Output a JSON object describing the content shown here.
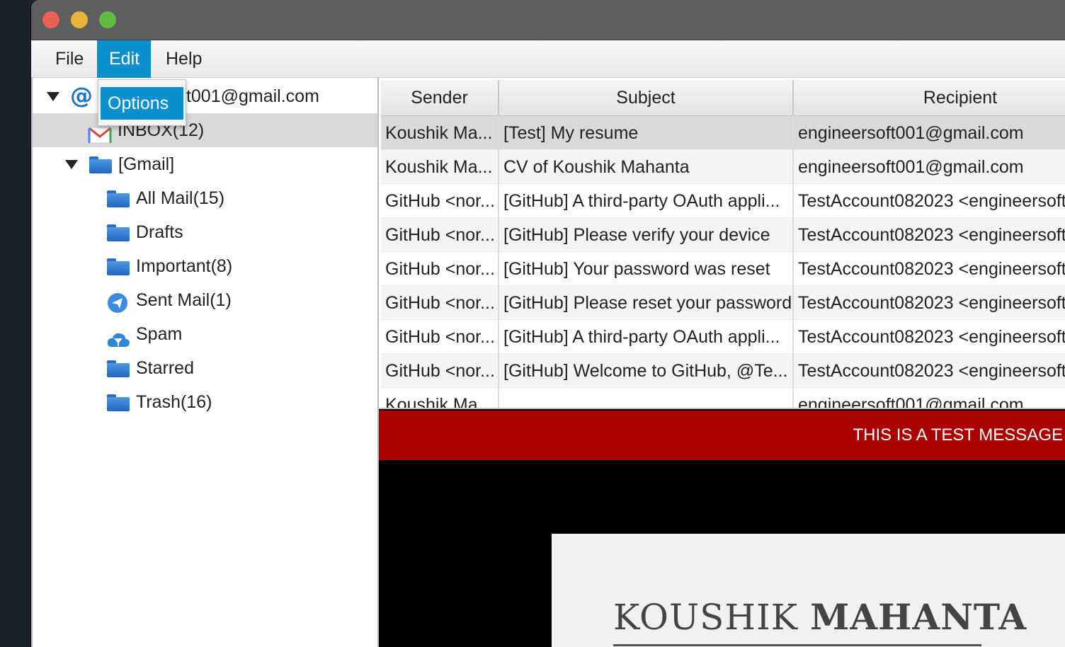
{
  "menu": {
    "file": "File",
    "edit": "Edit",
    "help": "Help"
  },
  "edit_menu": {
    "options": "Options"
  },
  "tree": {
    "account": "engineersoft001@gmail.com",
    "account_visible_tail": "ft001@gmail.com",
    "inbox": "INBOX(12)",
    "gmail": "[Gmail]",
    "folders": [
      "All Mail(15)",
      "Drafts",
      "Important(8)",
      "Sent Mail(1)",
      "Spam",
      "Starred",
      "Trash(16)"
    ]
  },
  "table": {
    "headers": [
      "Sender",
      "Subject",
      "Recipient"
    ],
    "rows": [
      [
        "Koushik Ma...",
        "[Test] My resume",
        "engineersoft001@gmail.com"
      ],
      [
        "Koushik Ma...",
        "CV of Koushik Mahanta",
        "engineersoft001@gmail.com"
      ],
      [
        "GitHub <nor...",
        "[GitHub] A third-party OAuth appli...",
        "TestAccount082023 <engineersoft"
      ],
      [
        "GitHub <nor...",
        "[GitHub] Please verify your device",
        "TestAccount082023 <engineersoft"
      ],
      [
        "GitHub <nor...",
        "[GitHub] Your password was reset",
        "TestAccount082023 <engineersoft"
      ],
      [
        "GitHub <nor...",
        "[GitHub] Please reset your password",
        "TestAccount082023 <engineersoft"
      ],
      [
        "GitHub <nor...",
        "[GitHub] A third-party OAuth appli...",
        "TestAccount082023 <engineersoft"
      ],
      [
        "GitHub <nor...",
        "[GitHub] Welcome to GitHub, @Te...",
        "TestAccount082023 <engineersoft"
      ],
      [
        "Koushik Ma...",
        "",
        "engineersoft001@gmail.com"
      ]
    ]
  },
  "preview": {
    "banner": "THIS IS A TEST MESSAGE",
    "name_first": "KOUSHIK",
    "name_last": "MAHANTA"
  },
  "colors": {
    "accent": "#0a90cf",
    "banner": "#aa0000",
    "selected_row": "#d9d9d9"
  }
}
